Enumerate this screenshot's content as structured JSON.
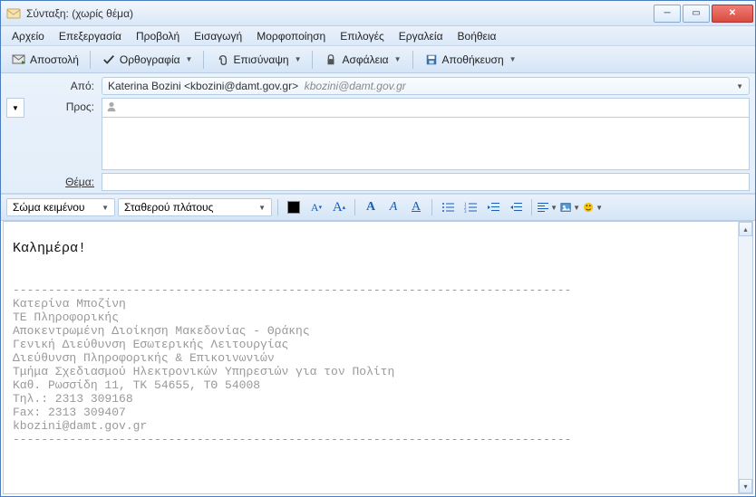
{
  "window": {
    "title": "Σύνταξη: (χωρίς θέμα)"
  },
  "menubar": {
    "file": "Αρχείο",
    "edit": "Επεξεργασία",
    "view": "Προβολή",
    "insert": "Εισαγωγή",
    "format": "Μορφοποίηση",
    "options": "Επιλογές",
    "tools": "Εργαλεία",
    "help": "Βοήθεια"
  },
  "toolbar": {
    "send": "Αποστολή",
    "spellcheck": "Ορθογραφία",
    "attach": "Επισύναψη",
    "security": "Ασφάλεια",
    "save": "Αποθήκευση"
  },
  "headers": {
    "from_label": "Από:",
    "from_value": "Katerina Bozini <kbozini@damt.gov.gr>",
    "from_email_gray": "kbozini@damt.gov.gr",
    "to_label": "Προς:",
    "to_value": "",
    "subject_label": "Θέμα:",
    "subject_value": ""
  },
  "format": {
    "paragraph_style": "Σώμα κειμένου",
    "font_family": "Σταθερού πλάτους"
  },
  "editor": {
    "greeting": "Καλημέρα!",
    "signature": "-------------------------------------------------------------------------------\nΚατερίνα Μποζίνη\nΤΕ Πληροφορικής\nΑποκεντρωμένη Διοίκηση Μακεδονίας - Θράκης\nΓενική Διεύθυνση Εσωτερικής Λειτουργίας\nΔιεύθυνση Πληροφορικής & Επικοινωνιών\nΤμήμα Σχεδιασμού Ηλεκτρονικών Υπηρεσιών για τον Πολίτη\nΚαθ. Ρωσσίδη 11, ΤΚ 54655, ΤΘ 54008\nΤηλ.: 2313 309168\nFax: 2313 309407\nkbozini@damt.gov.gr\n-------------------------------------------------------------------------------"
  }
}
